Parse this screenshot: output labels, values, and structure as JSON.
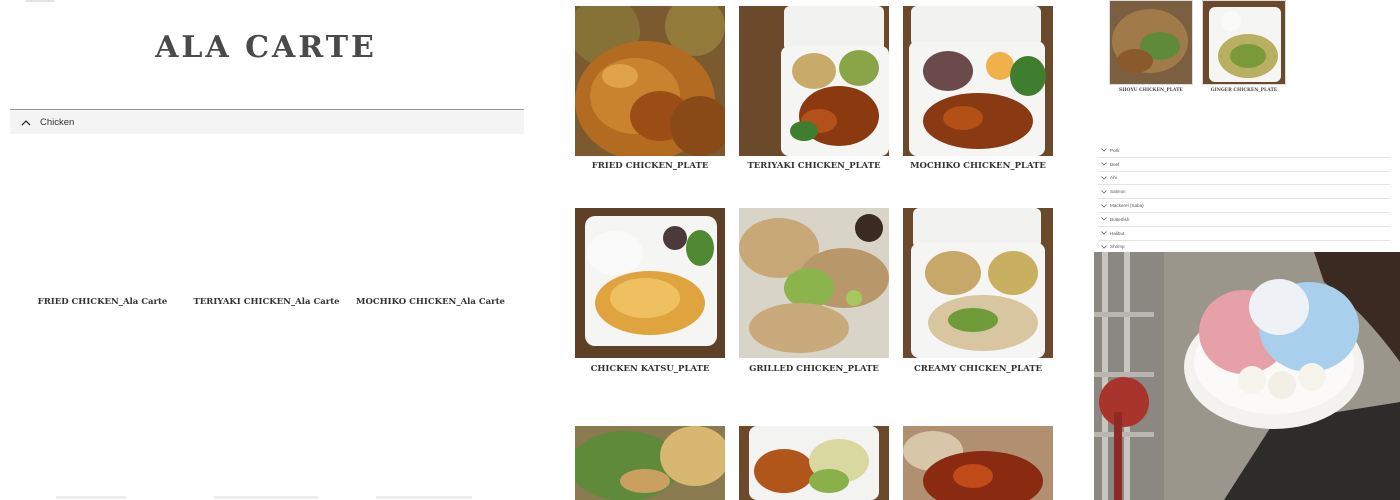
{
  "left": {
    "title": "ALA CARTE",
    "accordion": {
      "label": "Chicken",
      "icon": "chevron-up-icon",
      "expanded": true
    },
    "items": [
      {
        "label": "FRIED CHICKEN_Ala Carte"
      },
      {
        "label": "TERIYAKI CHICKEN_Ala Carte"
      },
      {
        "label": "MOCHIKO CHICKEN_Ala Carte"
      }
    ]
  },
  "plates": [
    {
      "label": "FRIED CHICKEN_PLATE",
      "icon": "fried-chicken-photo"
    },
    {
      "label": "TERIYAKI CHICKEN_PLATE",
      "icon": "teriyaki-chicken-photo"
    },
    {
      "label": "MOCHIKO CHICKEN_PLATE",
      "icon": "mochiko-chicken-photo"
    },
    {
      "label": "CHICKEN KATSU_PLATE",
      "icon": "chicken-katsu-photo"
    },
    {
      "label": "GRILLED CHICKEN_PLATE",
      "icon": "grilled-chicken-photo"
    },
    {
      "label": "CREAMY CHICKEN_PLATE",
      "icon": "creamy-chicken-photo"
    },
    {
      "label": "",
      "icon": "salad-photo"
    },
    {
      "label": "",
      "icon": "karaage-photo"
    },
    {
      "label": "",
      "icon": "glazed-chicken-photo"
    }
  ],
  "right": {
    "thumbs": [
      {
        "label": "SHOYU CHICKEN_PLATE",
        "icon": "shoyu-chicken-photo"
      },
      {
        "label": "GINGER CHICKEN_PLATE",
        "icon": "ginger-chicken-photo"
      }
    ],
    "categories": [
      {
        "label": "Pork"
      },
      {
        "label": "Beef"
      },
      {
        "label": "Ahi"
      },
      {
        "label": "Salmon"
      },
      {
        "label": "Mackerel (Saba)"
      },
      {
        "label": "Butterfish"
      },
      {
        "label": "Halibut"
      },
      {
        "label": "Shrimp"
      }
    ],
    "photo": {
      "icon": "shave-ice-photo"
    }
  },
  "colors": {
    "accent_text": "#4a4a4a",
    "accordion_bg": "#f4f4f4",
    "wood": "#6b4a2b",
    "container": "#f2f2f0"
  }
}
